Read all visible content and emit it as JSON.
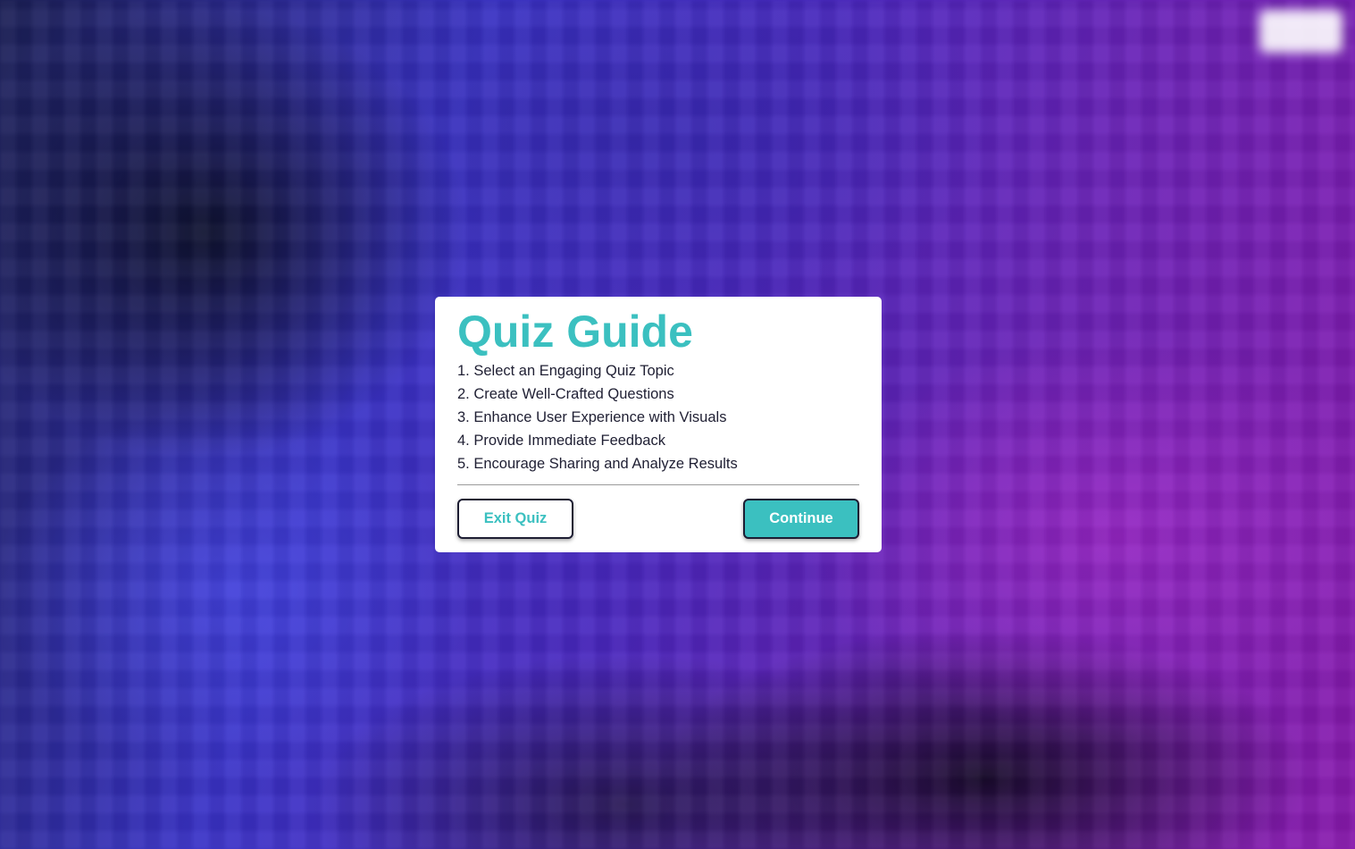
{
  "colors": {
    "accent": "#3bc0c0",
    "text": "#1f1f33",
    "modal_background": "#ffffff"
  },
  "nav": {
    "links": [
      "",
      "",
      ""
    ],
    "button_label": ""
  },
  "modal": {
    "title": "Quiz Guide",
    "items": [
      "1. Select an Engaging Quiz Topic",
      "2. Create Well-Crafted Questions",
      "3. Enhance User Experience with Visuals",
      "4. Provide Immediate Feedback",
      "5. Encourage Sharing and Analyze Results"
    ],
    "exit_label": "Exit Quiz",
    "continue_label": "Continue"
  }
}
